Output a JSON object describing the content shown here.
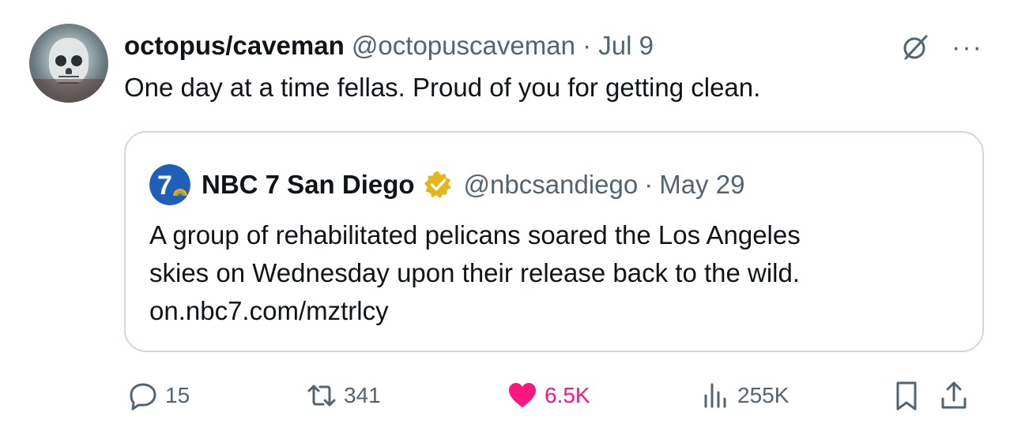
{
  "tweet": {
    "author_name": "octopus/caveman",
    "author_handle": "@octopuscaveman",
    "separator": "·",
    "date": "Jul 9",
    "text": "One day at a time fellas. Proud of you for getting clean."
  },
  "quoted_tweet": {
    "logo_text": "7",
    "author_name": "NBC 7 San Diego",
    "verified": true,
    "author_handle": "@nbcsandiego",
    "separator": "·",
    "date": "May 29",
    "text_lines": [
      "A group of rehabilitated pelicans soared the Los Angeles",
      "skies on Wednesday upon their release back to the wild.",
      "on.nbc7.com/mztrlcy"
    ]
  },
  "actions": {
    "replies": "15",
    "reposts": "341",
    "likes": "6.5K",
    "views": "255K"
  },
  "icons": [
    "grok-icon",
    "more-icon",
    "reply-icon",
    "repost-icon",
    "heart-icon",
    "views-icon",
    "bookmark-icon",
    "share-icon"
  ],
  "colors": {
    "text": "#0f1419",
    "secondary": "#536471",
    "like": "#f91880",
    "border": "#cfd9de",
    "verified_gold": "#e2b719",
    "nbc_blue": "#1f5fb8"
  },
  "top_more_label": "···"
}
